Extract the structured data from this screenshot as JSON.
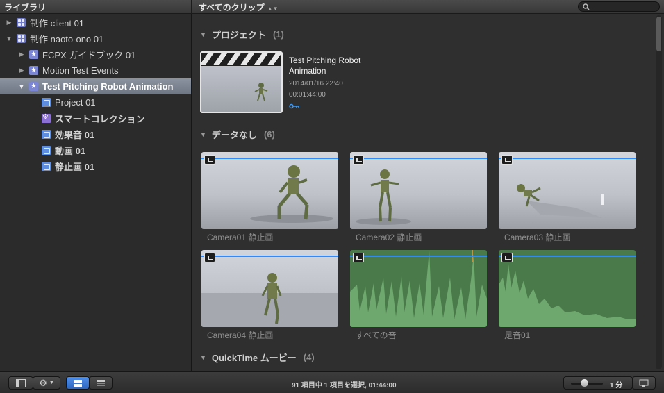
{
  "topbar": {
    "library_title": "ライブラリ",
    "clip_filter": "すべてのクリップ",
    "search_placeholder": ""
  },
  "sidebar": {
    "items": [
      {
        "label": "制作 client 01",
        "icon": "library-icon",
        "disclosure": "▶",
        "indent": 0
      },
      {
        "label": "制作 naoto-ono 01",
        "icon": "library-icon",
        "disclosure": "▼",
        "indent": 0
      },
      {
        "label": "FCPX ガイドブック 01",
        "icon": "event-icon",
        "disclosure": "▶",
        "indent": 1
      },
      {
        "label": "Motion Test Events",
        "icon": "event-icon",
        "disclosure": "▶",
        "indent": 1
      },
      {
        "label": "Test Pitching Robot Animation",
        "icon": "event-icon",
        "disclosure": "▼",
        "indent": 1,
        "selected": true
      },
      {
        "label": "Project 01",
        "icon": "project-icon",
        "indent": 2
      },
      {
        "label": "スマートコレクション",
        "icon": "smart-collection-icon",
        "indent": 2
      },
      {
        "label": "効果音 01",
        "icon": "project-icon",
        "indent": 2
      },
      {
        "label": "動画 01",
        "icon": "project-icon",
        "indent": 2
      },
      {
        "label": "静止画 01",
        "icon": "project-icon",
        "indent": 2
      }
    ]
  },
  "browser": {
    "sections": [
      {
        "title": "プロジェクト",
        "count": "(1)"
      },
      {
        "title": "データなし",
        "count": "(6)"
      },
      {
        "title": "QuickTime ムービー",
        "count": "(4)"
      }
    ],
    "project": {
      "name": "Test Pitching Robot Animation",
      "date": "2014/01/16 22:40",
      "duration": "00:01:44:00"
    },
    "clips": [
      {
        "label": "Camera01 静止画",
        "kind": "video"
      },
      {
        "label": "Camera02 静止画",
        "kind": "video"
      },
      {
        "label": "Camera03 静止画",
        "kind": "video"
      },
      {
        "label": "Camera04 静止画",
        "kind": "video"
      },
      {
        "label": "すべての音",
        "kind": "audio"
      },
      {
        "label": "足音01",
        "kind": "audio"
      }
    ]
  },
  "bottombar": {
    "status": "91 項目中 1 項目を選択, 01:44:00",
    "zoom_label": "1 分"
  },
  "colors": {
    "accent": "#2c8cff",
    "selection": "#7b828e",
    "audio_green": "#4a7a4a"
  }
}
